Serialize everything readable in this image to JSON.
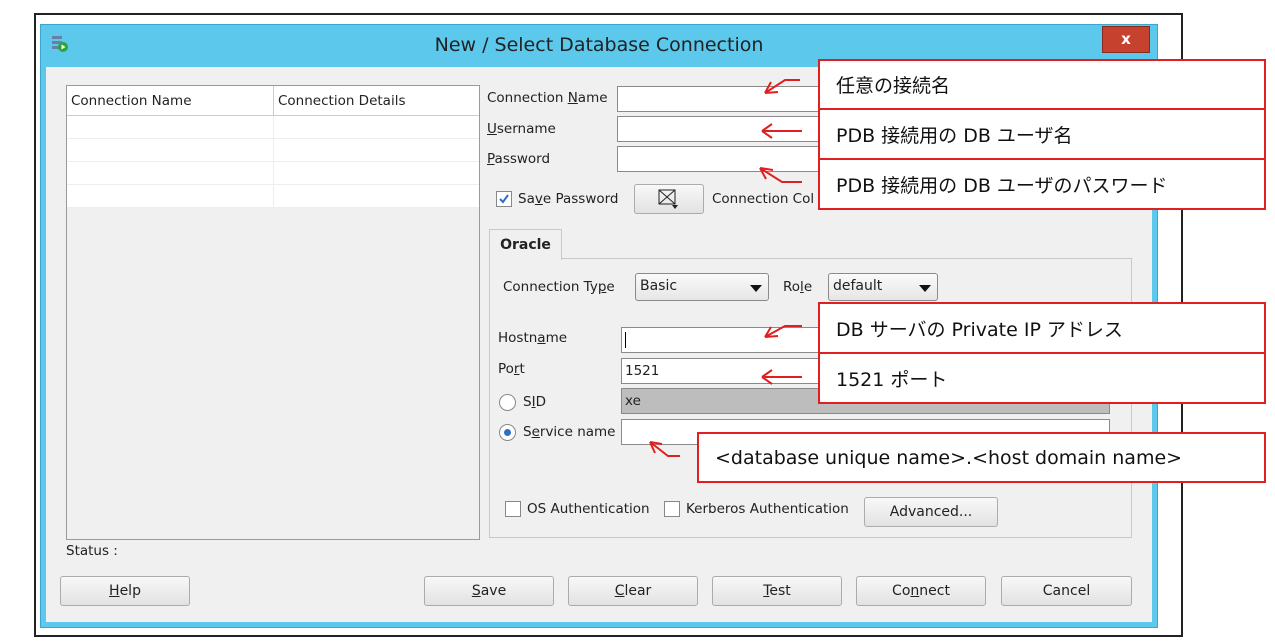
{
  "window": {
    "title": "New / Select Database Connection",
    "close_label": "x"
  },
  "table": {
    "columns": [
      "Connection Name",
      "Connection Details"
    ],
    "rows": [
      [
        "",
        ""
      ],
      [
        "",
        ""
      ],
      [
        "",
        ""
      ],
      [
        "",
        ""
      ]
    ]
  },
  "form": {
    "connection_name": {
      "label_pre": "Connection ",
      "label_key": "N",
      "label_post": "ame",
      "value": ""
    },
    "username": {
      "label_pre": "",
      "label_key": "U",
      "label_post": "sername",
      "value": ""
    },
    "password": {
      "label_pre": "",
      "label_key": "P",
      "label_post": "assword",
      "value": ""
    },
    "save_password": {
      "label_pre": "Sa",
      "label_key": "v",
      "label_post": "e Password",
      "checked": true
    },
    "connection_color_label": "Connection Col"
  },
  "oracle_tab": {
    "tab_label": "Oracle",
    "connection_type": {
      "label_pre": "Connection Ty",
      "label_key": "p",
      "label_post": "e",
      "value": "Basic"
    },
    "role": {
      "label_pre": "Ro",
      "label_key": "l",
      "label_post": "e",
      "value": "default"
    },
    "hostname": {
      "label_pre": "Hostn",
      "label_key": "a",
      "label_post": "me",
      "value": ""
    },
    "port": {
      "label_pre": "Po",
      "label_key": "r",
      "label_post": "t",
      "value": "1521"
    },
    "sid": {
      "label_pre": "S",
      "label_key": "I",
      "label_post": "D",
      "value": "xe",
      "selected": false
    },
    "service_name": {
      "label_pre": "S",
      "label_key": "e",
      "label_post": "rvice name",
      "value": "",
      "selected": true
    },
    "os_auth": {
      "label": "OS Authentication",
      "checked": false
    },
    "kerberos_auth": {
      "label": "Kerberos Authentication",
      "checked": false
    },
    "advanced_label": "Advanced..."
  },
  "status_label": "Status :",
  "buttons": {
    "help": {
      "pre": "",
      "key": "H",
      "post": "elp"
    },
    "save": {
      "pre": "",
      "key": "S",
      "post": "ave"
    },
    "clear": {
      "pre": "",
      "key": "C",
      "post": "lear"
    },
    "test": {
      "pre": "",
      "key": "T",
      "post": "est"
    },
    "connect": {
      "pre": "Co",
      "key": "n",
      "post": "nect"
    },
    "cancel": {
      "pre": "Cancel",
      "key": "",
      "post": ""
    }
  },
  "annotations": {
    "connection_name": "任意の接続名",
    "username": "PDB 接続用の DB ユーザ名",
    "password": "PDB 接続用の DB ユーザのパスワード",
    "hostname": "DB サーバの Private IP アドレス",
    "port": "1521 ポート",
    "service_name": "<database unique name>.<host domain name>"
  },
  "colors": {
    "titlebar": "#5bc8ec",
    "close_button": "#c7412f",
    "annotation": "#e02020"
  }
}
